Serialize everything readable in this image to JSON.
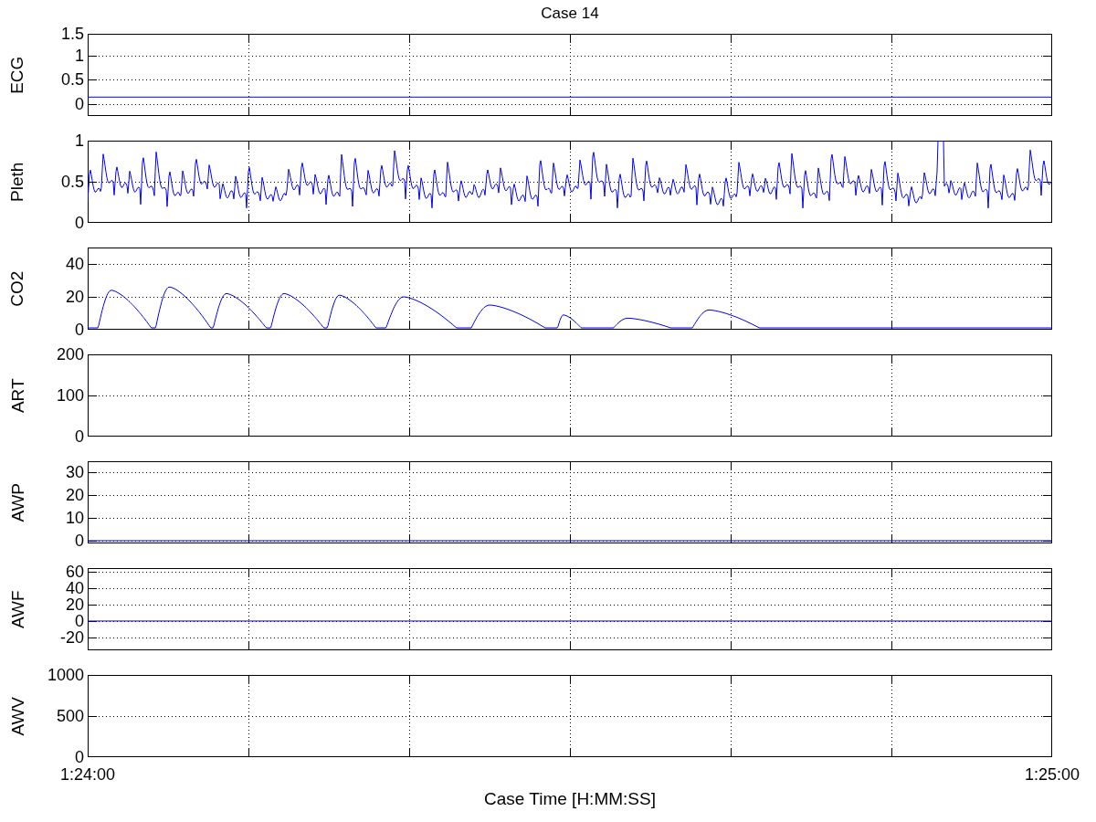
{
  "title": "Case 14",
  "panels": [
    {
      "label": "ECG",
      "yticks": [
        "1.5",
        "1",
        "0.5",
        "0"
      ],
      "kind": "flat-lower"
    },
    {
      "label": "Pleth",
      "yticks": [
        "1",
        "0.5",
        "0"
      ],
      "kind": "pleth"
    },
    {
      "label": "CO2",
      "yticks": [
        "40",
        "20",
        "0"
      ],
      "kind": "capnogram"
    },
    {
      "label": "ART",
      "yticks": [
        "200",
        "100",
        "0"
      ],
      "kind": "empty"
    },
    {
      "label": "AWP",
      "yticks": [
        "30",
        "20",
        "10",
        "0"
      ],
      "kind": "flat-bottom"
    },
    {
      "label": "AWF",
      "yticks": [
        "60",
        "40",
        "20",
        "0",
        "-20"
      ],
      "kind": "flat-middle"
    },
    {
      "label": "AWV",
      "yticks": [
        "1000",
        "500",
        "0"
      ],
      "kind": "empty"
    }
  ],
  "xticks": [
    "1:24:00",
    "1:25:00"
  ],
  "xlabel": "Case Time [H:MM:SS]"
}
